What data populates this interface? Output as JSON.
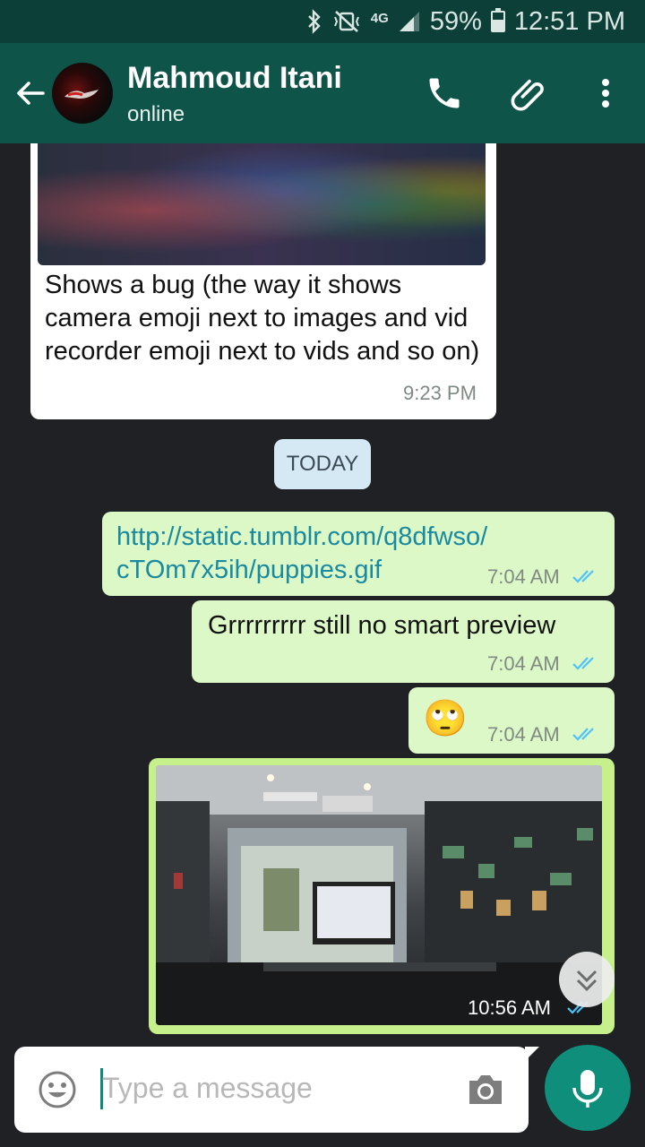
{
  "status_bar": {
    "network": "4G",
    "battery": "59%",
    "battery_level": 0.59,
    "time": "12:51 PM",
    "icons": [
      "bluetooth-icon",
      "vibrate-mute-icon",
      "signal-icon",
      "battery-icon"
    ]
  },
  "header": {
    "contact_name": "Mahmoud Itani",
    "status": "online",
    "icons": [
      "back-arrow-icon",
      "phone-icon",
      "attachment-icon",
      "more-vert-icon"
    ]
  },
  "messages": {
    "incoming_caption": {
      "text": "Shows a bug (the way it shows camera emoji next to images and vid recorder emoji next to vids and so on)",
      "time": "9:23 PM"
    },
    "date_divider": "TODAY",
    "link": {
      "line1": "http://static.tumblr.com/q8dfwso/",
      "line2": "cTOm7x5ih/puppies.gif",
      "time": "7:04 AM"
    },
    "text_msg": {
      "text": "Grrrrrrrrr still no smart preview",
      "time": "7:04 AM"
    },
    "emoji_msg": {
      "emoji": "🙄",
      "time": "7:04 AM"
    },
    "photo_msg": {
      "time": "10:56 AM"
    }
  },
  "input": {
    "placeholder": "Type a message"
  },
  "colors": {
    "header": "#0f5448",
    "status_bar": "#0b3f37",
    "outgoing_bubble": "#dcf8c6",
    "incoming_bubble": "#ffffff",
    "read_tick": "#4fc3f7",
    "fab": "#0f8f7b"
  }
}
